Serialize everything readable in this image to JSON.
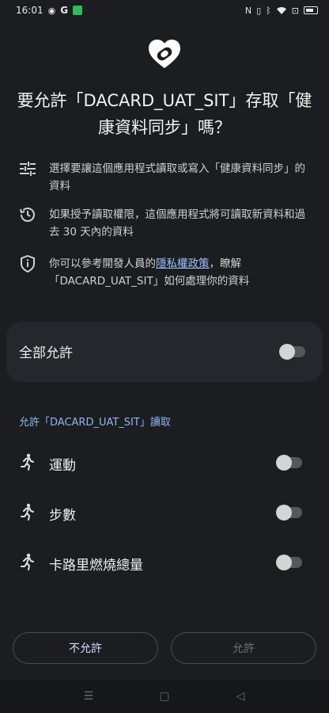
{
  "status_bar": {
    "time": "16:01",
    "left_icons": [
      "messenger-icon",
      "google-icon",
      "app-notification-icon"
    ],
    "right_icons": [
      "nfc-icon",
      "vibrate-icon",
      "bluetooth-icon",
      "wifi-icon",
      "battery-saver-icon",
      "battery-icon"
    ]
  },
  "dialog": {
    "title": "要允許「DACARD_UAT_SIT」存取「健康資料同步」嗎？",
    "info": [
      {
        "icon": "sliders-icon",
        "text": "選擇要讓這個應用程式讀取或寫入「健康資料同步」的資料"
      },
      {
        "icon": "history-icon",
        "text": "如果授予讀取權限，這個應用程式將可讀取新資料和過去 30 天內的資料"
      }
    ],
    "privacy": {
      "icon": "shield-icon",
      "prefix": "你可以參考開發人員的",
      "link": "隱私權政策",
      "suffix": "，瞭解「DACARD_UAT_SIT」如何處理你的資料"
    },
    "allow_all": {
      "label": "全部允許",
      "enabled": false
    },
    "section_header": "允許「DACARD_UAT_SIT」讀取",
    "permissions": [
      {
        "label": "運動",
        "icon": "running-icon",
        "enabled": false
      },
      {
        "label": "步數",
        "icon": "running-icon",
        "enabled": false
      },
      {
        "label": "卡路里燃燒總量",
        "icon": "running-icon",
        "enabled": false
      }
    ],
    "buttons": {
      "deny": "不允許",
      "allow": "允許"
    }
  },
  "colors": {
    "background": "#1c1d20",
    "card": "#25272c",
    "accent": "#8fb7f5",
    "link": "#9cc3ff"
  }
}
